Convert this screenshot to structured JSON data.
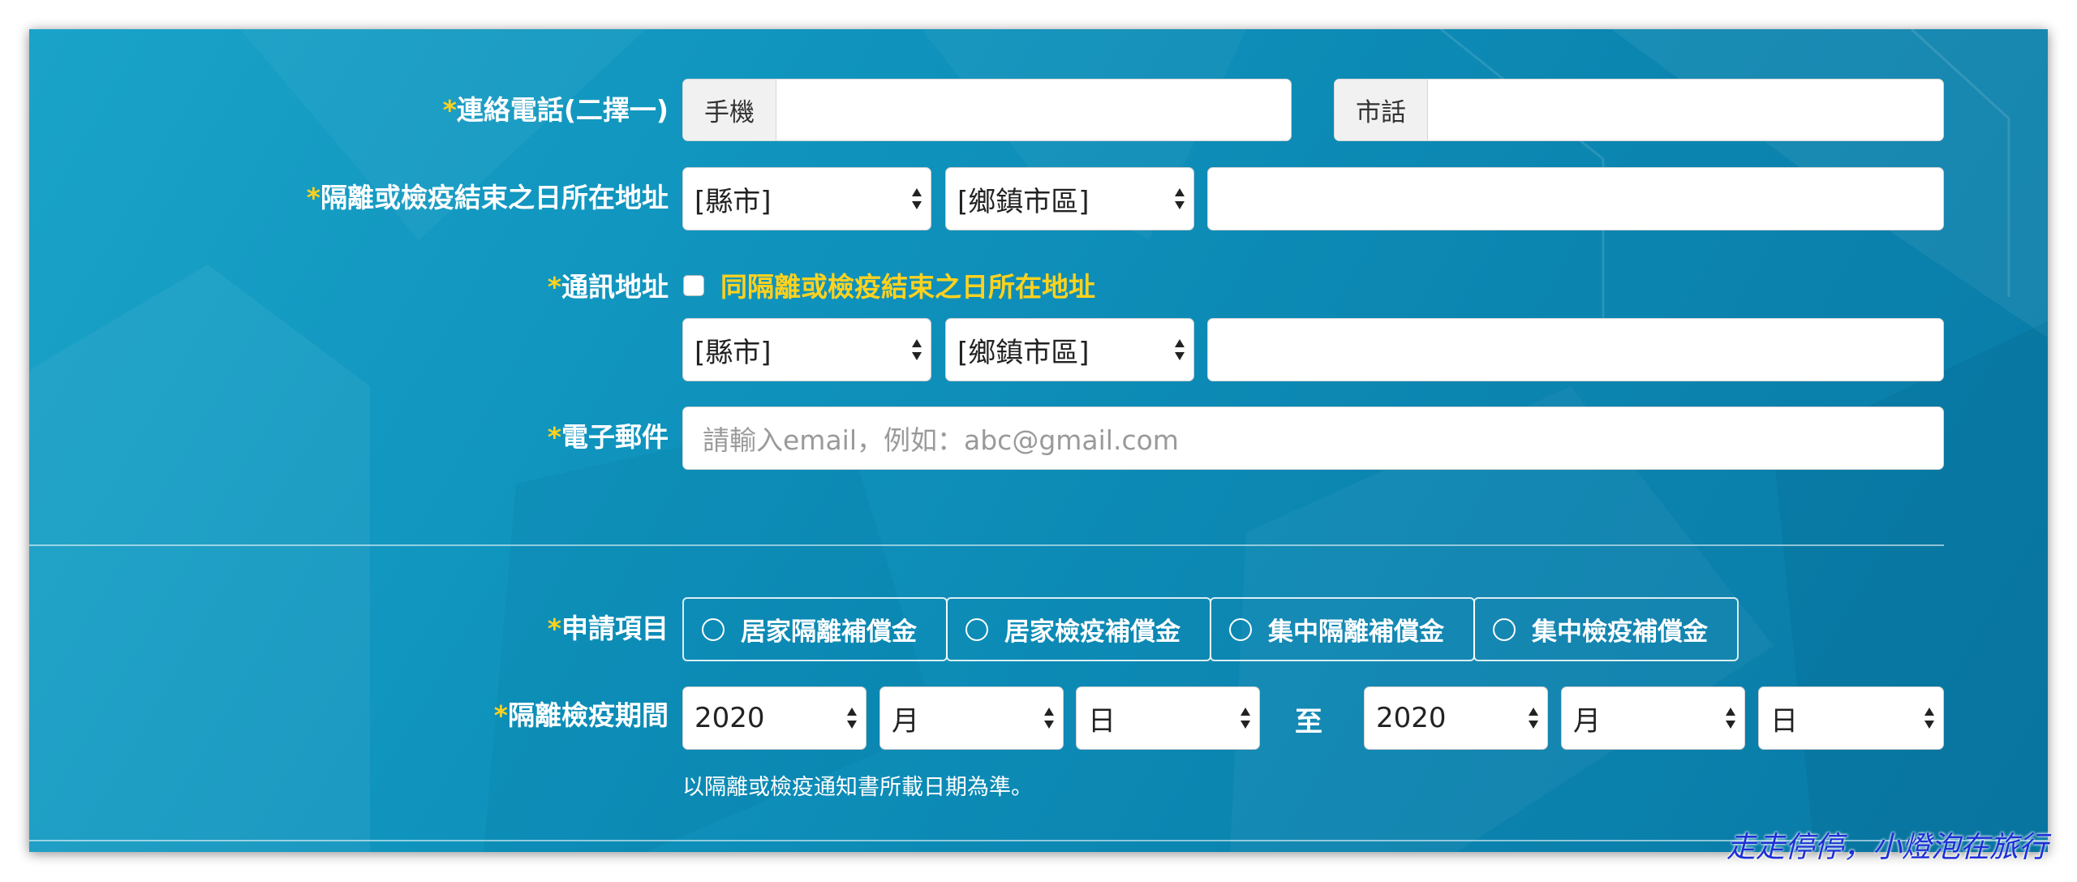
{
  "labels": {
    "required_mark": "*",
    "phone": "連絡電話(二擇一)",
    "quarantine_address": "隔離或檢疫結束之日所在地址",
    "mailing_address": "通訊地址",
    "email": "電子郵件",
    "apply_item": "申請項目",
    "period": "隔離檢疫期間"
  },
  "phone": {
    "mobile_prefix": "手機",
    "mobile_value": "",
    "landline_prefix": "市話",
    "landline_value": ""
  },
  "quarantine_address": {
    "city": "[縣市]",
    "district": "[鄉鎮市區]",
    "street": ""
  },
  "mailing_address": {
    "same_as_label": "同隔離或檢疫結束之日所在地址",
    "same_checked": false,
    "city": "[縣市]",
    "district": "[鄉鎮市區]",
    "street": ""
  },
  "email": {
    "value": "",
    "placeholder": "請輸入email，例如：abc@gmail.com"
  },
  "apply_items": [
    {
      "label": "居家隔離補償金",
      "selected": false
    },
    {
      "label": "居家檢疫補償金",
      "selected": false
    },
    {
      "label": "集中隔離補償金",
      "selected": false
    },
    {
      "label": "集中檢疫補償金",
      "selected": false
    }
  ],
  "period": {
    "start_year": "2020",
    "start_month": "月",
    "start_day": "日",
    "to": "至",
    "end_year": "2020",
    "end_month": "月",
    "end_day": "日",
    "note": "以隔離或檢疫通知書所載日期為準。"
  },
  "watermark": "走走停停，小燈泡在旅行",
  "colors": {
    "panel_bg": "#0f93bd",
    "label_text": "#ffffff",
    "required_star": "#ffd21e",
    "checkbox_label": "#ffd21e",
    "watermark": "#1c2fd6"
  }
}
